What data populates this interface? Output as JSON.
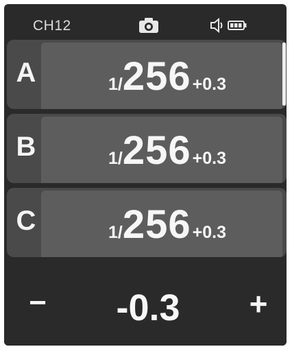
{
  "status_bar": {
    "channel": "CH12",
    "icons": [
      "camera-icon",
      "speaker-icon",
      "battery-icon"
    ]
  },
  "groups": [
    {
      "letter": "A",
      "power_numerator": "1",
      "power_slash": "/",
      "power_denominator": "256",
      "compensation": "+0.3"
    },
    {
      "letter": "B",
      "power_numerator": "1",
      "power_slash": "/",
      "power_denominator": "256",
      "compensation": "+0.3"
    },
    {
      "letter": "C",
      "power_numerator": "1",
      "power_slash": "/",
      "power_denominator": "256",
      "compensation": "+0.3"
    }
  ],
  "control": {
    "minus_label": "−",
    "value": "-0.3",
    "plus_label": "+"
  }
}
